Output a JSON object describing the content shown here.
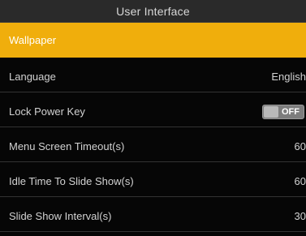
{
  "title": "User Interface",
  "items": [
    {
      "label": "Wallpaper",
      "value": ""
    },
    {
      "label": "Language",
      "value": "English"
    },
    {
      "label": "Lock Power Key",
      "value": ""
    },
    {
      "label": "Menu Screen Timeout(s)",
      "value": "60"
    },
    {
      "label": "Idle Time To Slide Show(s)",
      "value": "60"
    },
    {
      "label": "Slide Show Interval(s)",
      "value": "30"
    }
  ],
  "lock_power_key": {
    "state": "OFF",
    "on": false
  },
  "colors": {
    "selected": "#f0ae0c",
    "title_bar": "#2a2a2a",
    "background": "#060606"
  }
}
